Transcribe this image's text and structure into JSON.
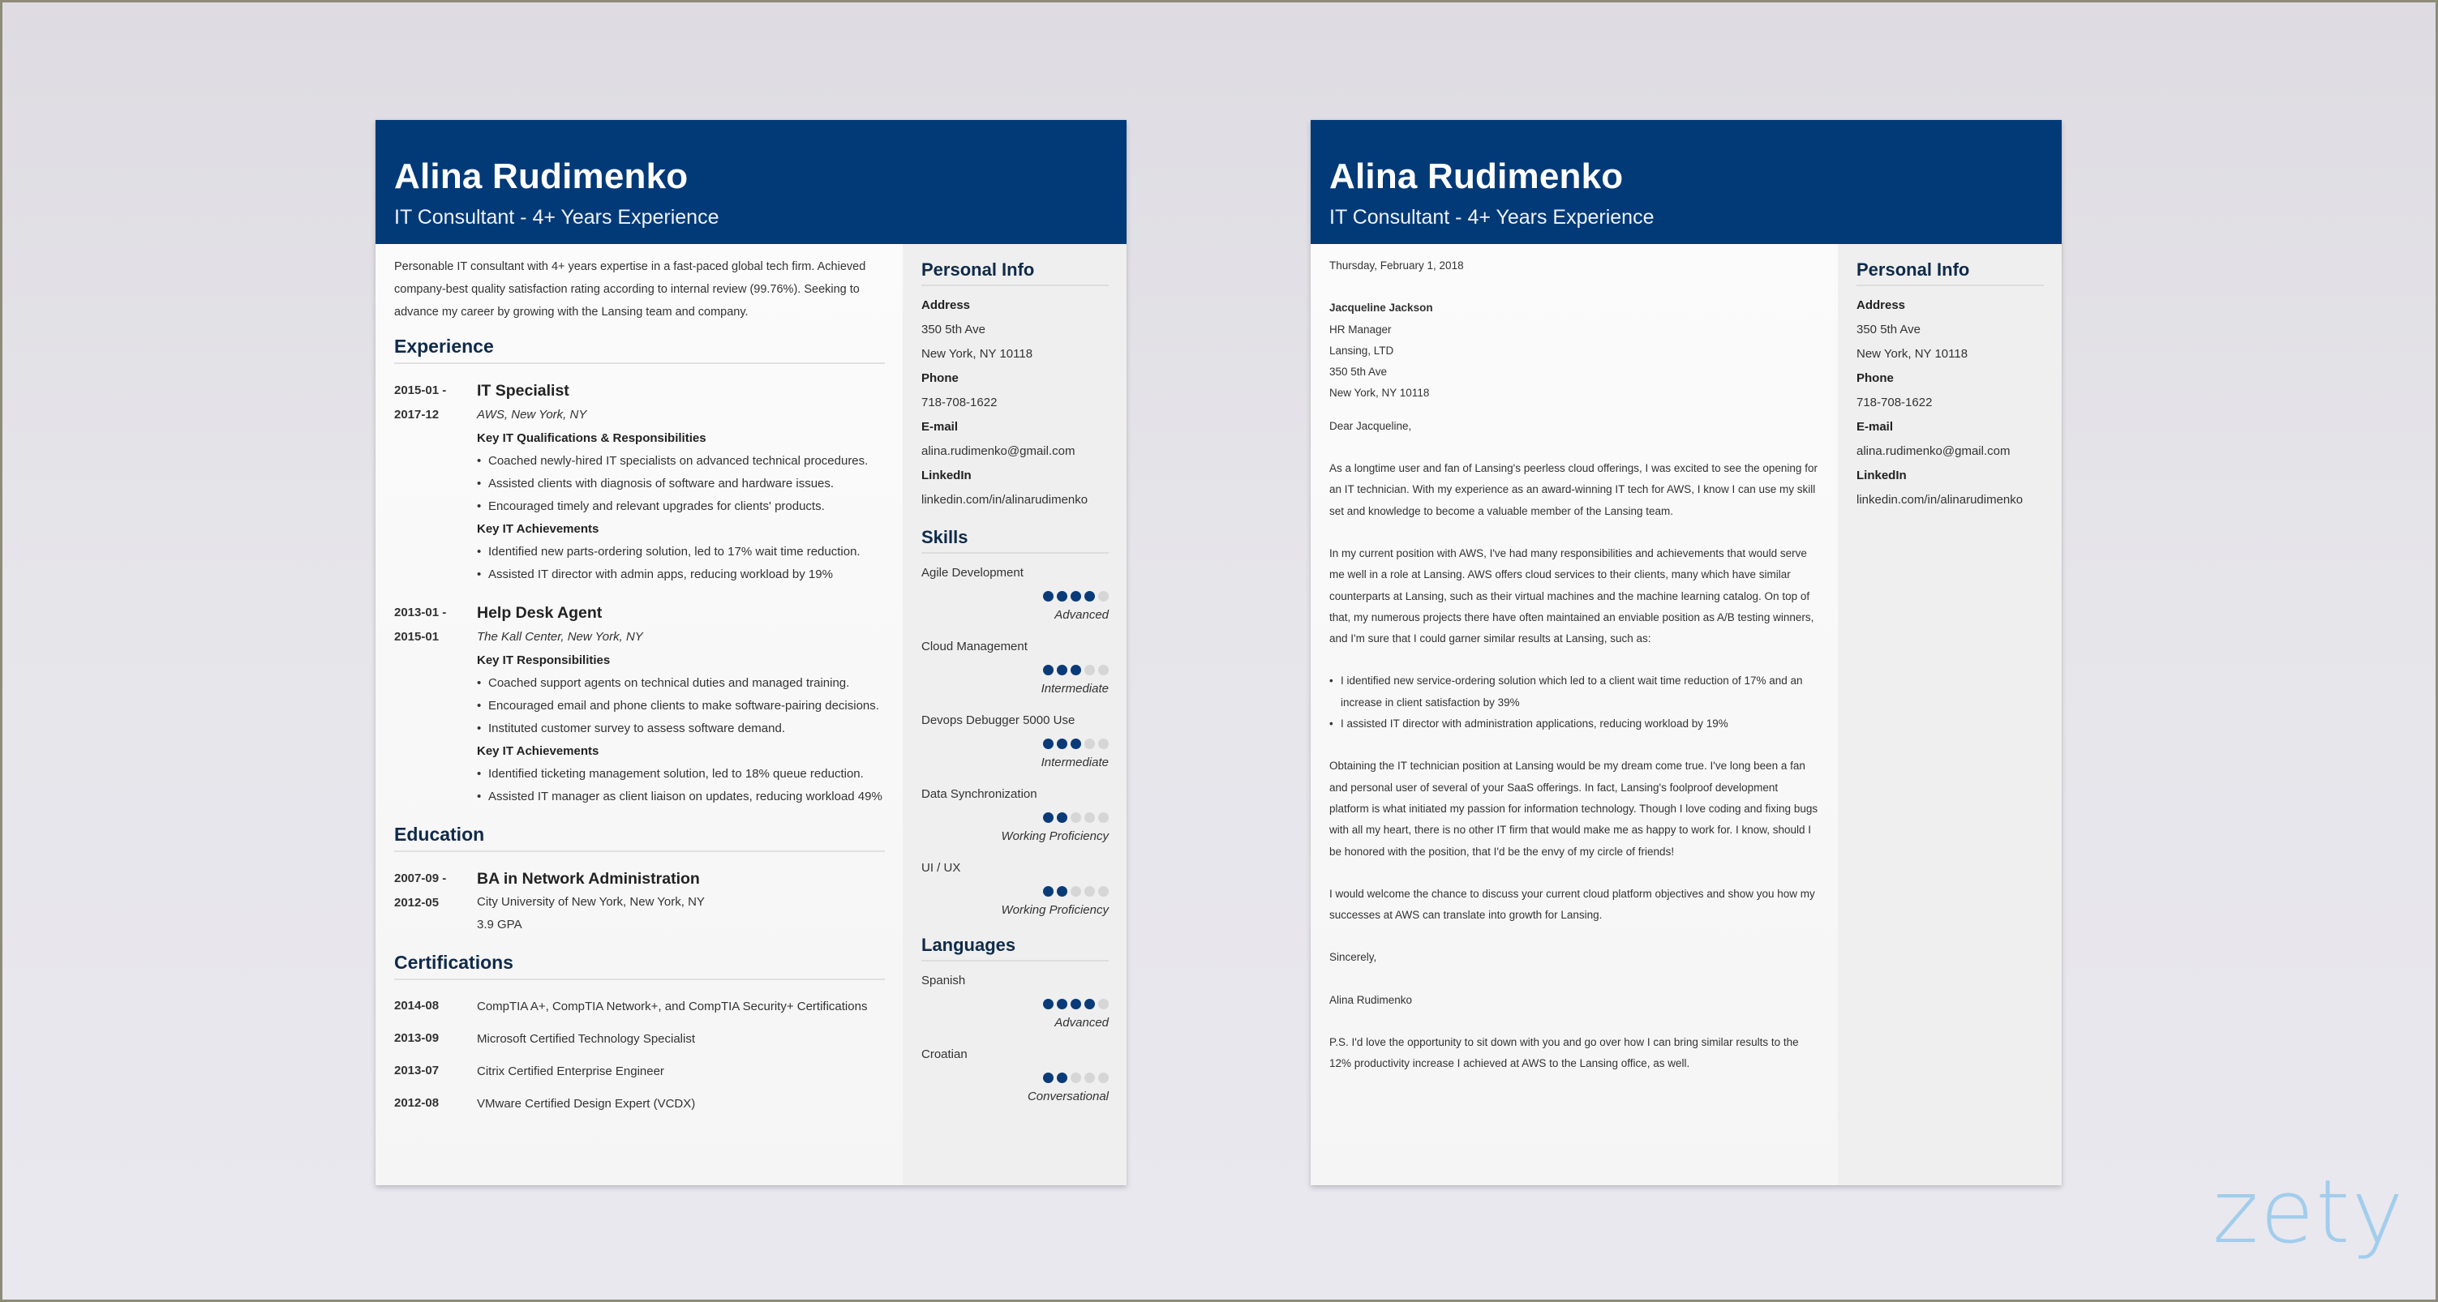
{
  "resume": {
    "header": {
      "name": "Alina Rudimenko",
      "subtitle": "IT Consultant - 4+ Years Experience"
    },
    "summary": "Personable IT consultant with 4+ years expertise in a fast-paced global tech firm. Achieved company-best quality satisfaction rating according to internal review (99.76%). Seeking to advance my career by growing with the Lansing team and company.",
    "experience": {
      "title": "Experience",
      "jobs": [
        {
          "date_start": "2015-01 -",
          "date_end": "2017-12",
          "title": "IT Specialist",
          "org": "AWS, New York, NY",
          "groups": [
            {
              "heading": "Key IT Qualifications & Responsibilities",
              "items": [
                "Coached newly-hired IT specialists on advanced technical procedures.",
                "Assisted clients with diagnosis of software and hardware issues.",
                "Encouraged timely and relevant upgrades for clients' products."
              ]
            },
            {
              "heading": "Key IT Achievements",
              "items": [
                "Identified new parts-ordering solution, led to 17% wait time reduction.",
                "Assisted IT director with admin apps, reducing workload by 19%"
              ]
            }
          ]
        },
        {
          "date_start": "2013-01 -",
          "date_end": "2015-01",
          "title": "Help Desk Agent",
          "org": "The Kall Center, New York, NY",
          "groups": [
            {
              "heading": "Key IT Responsibilities",
              "items": [
                "Coached support agents on technical duties and managed training.",
                "Encouraged email and phone clients to make software-pairing decisions.",
                "Instituted customer survey to assess software demand."
              ]
            },
            {
              "heading": "Key IT Achievements",
              "items": [
                "Identified ticketing management solution, led to 18% queue reduction.",
                "Assisted IT manager as client liaison on updates, reducing workload 49%"
              ]
            }
          ]
        }
      ]
    },
    "education": {
      "title": "Education",
      "date_start": "2007-09 -",
      "date_end": "2012-05",
      "degree": "BA in Network Administration",
      "school": "City University of New York, New York, NY",
      "gpa": "3.9 GPA"
    },
    "certifications": {
      "title": "Certifications",
      "items": [
        {
          "date": "2014-08",
          "text": "CompTIA A+, CompTIA Network+, and CompTIA Security+ Certifications"
        },
        {
          "date": "2013-09",
          "text": "Microsoft Certified Technology Specialist"
        },
        {
          "date": "2013-07",
          "text": "Citrix Certified Enterprise Engineer"
        },
        {
          "date": "2012-08",
          "text": "VMware Certified Design Expert (VCDX)"
        }
      ]
    },
    "sidebar": {
      "personal_info": {
        "title": "Personal Info",
        "address_label": "Address",
        "address_line1": "350 5th Ave",
        "address_line2": "New York, NY 10118",
        "phone_label": "Phone",
        "phone": "718-708-1622",
        "email_label": "E-mail",
        "email": "alina.rudimenko@gmail.com",
        "linkedin_label": "LinkedIn",
        "linkedin": "linkedin.com/in/alinarudimenko"
      },
      "skills": {
        "title": "Skills",
        "items": [
          {
            "name": "Agile Development",
            "rating": 4,
            "max": 5,
            "level": "Advanced"
          },
          {
            "name": "Cloud Management",
            "rating": 3,
            "max": 5,
            "level": "Intermediate"
          },
          {
            "name": "Devops Debugger 5000 Use",
            "rating": 3,
            "max": 5,
            "level": "Intermediate"
          },
          {
            "name": "Data Synchronization",
            "rating": 2,
            "max": 5,
            "level": "Working Proficiency"
          },
          {
            "name": "UI / UX",
            "rating": 2,
            "max": 5,
            "level": "Working Proficiency"
          }
        ]
      },
      "languages": {
        "title": "Languages",
        "items": [
          {
            "name": "Spanish",
            "rating": 4,
            "max": 5,
            "level": "Advanced"
          },
          {
            "name": "Croatian",
            "rating": 2,
            "max": 5,
            "level": "Conversational"
          }
        ]
      }
    }
  },
  "letter": {
    "header": {
      "name": "Alina Rudimenko",
      "subtitle": "IT Consultant - 4+ Years Experience"
    },
    "date": "Thursday, February 1, 2018",
    "recipient": {
      "name": "Jacqueline Jackson",
      "title": "HR Manager",
      "company": "Lansing, LTD",
      "street": "350 5th Ave",
      "city": "New York, NY 10118"
    },
    "greeting": "Dear Jacqueline,",
    "paragraph1": "As a longtime user and fan of Lansing's peerless cloud offerings, I was excited to see the opening for an IT technician. With my experience as an award-winning IT tech for AWS, I know I can use my skill set and knowledge to become a valuable member of the Lansing team.",
    "paragraph2": "In my current position with AWS, I've had many responsibilities and achievements that would serve me well in a role at Lansing. AWS offers cloud services to their clients, many which have similar counterparts at Lansing, such as their virtual machines and the machine learning catalog. On top of that, my numerous projects there have often maintained an enviable position as A/B testing winners, and I'm sure that I could garner similar results at Lansing, such as:",
    "bullets": [
      "I identified new service-ordering solution which led to a client wait time reduction of 17% and an increase in client satisfaction by 39%",
      "I assisted IT director with administration applications, reducing workload by 19%"
    ],
    "paragraph3": "Obtaining the IT technician position at Lansing would be my dream come true. I've long been a fan and personal user of several of your SaaS offerings. In fact, Lansing's foolproof development platform is what initiated my passion for information technology. Though I love coding and fixing bugs with all my heart, there is no other IT firm that would make me as happy to work for. I know, should I be honored with the position, that I'd be the envy of my circle of friends!",
    "paragraph4": "I would welcome the chance to discuss your current cloud platform objectives and show you how my successes at AWS can translate into growth for Lansing.",
    "closing": "Sincerely,",
    "signature": "Alina Rudimenko",
    "postscript": "P.S. I'd love the opportunity to sit down with you and go over how I can bring similar results to the 12% productivity increase I achieved at AWS to the Lansing office, as well.",
    "sidebar": {
      "title": "Personal Info",
      "address_label": "Address",
      "address_line1": "350 5th Ave",
      "address_line2": "New York, NY 10118",
      "phone_label": "Phone",
      "phone": "718-708-1622",
      "email_label": "E-mail",
      "email": "alina.rudimenko@gmail.com",
      "linkedin_label": "LinkedIn",
      "linkedin": "linkedin.com/in/alinarudimenko"
    }
  },
  "brand": {
    "logo_text": "zety",
    "colors": {
      "header_navy": "#023a78",
      "dot_filled": "#0a3b78",
      "dot_empty": "#d6d6d6",
      "logo_blue": "#a2cdec"
    }
  }
}
